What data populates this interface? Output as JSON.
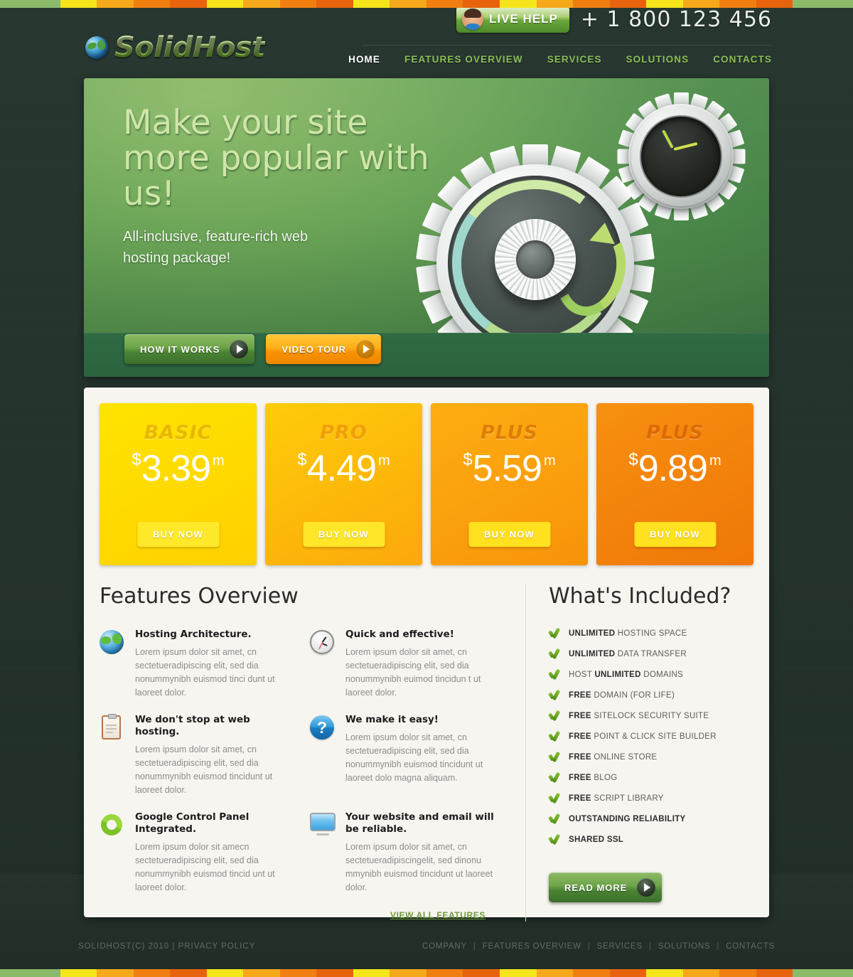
{
  "brand": {
    "name": "SolidHost",
    "logo_icon": "globe-icon"
  },
  "topbar": {
    "live_help_label": "LIVE HELP",
    "live_help_icon": "support-agent-avatar",
    "phone": "+ 1 800 123 456"
  },
  "nav": [
    {
      "label": "HOME",
      "active": true
    },
    {
      "label": "FEATURES OVERVIEW",
      "active": false
    },
    {
      "label": "SERVICES",
      "active": false
    },
    {
      "label": "SOLUTIONS",
      "active": false
    },
    {
      "label": "CONTACTS",
      "active": false
    }
  ],
  "hero": {
    "headline": "Make your site more popular with us!",
    "subhead": "All-inclusive, feature-rich web hosting package!",
    "primary_button": "HOW IT WORKS",
    "secondary_button": "VIDEO TOUR",
    "illustration": "gears-and-clock-icon"
  },
  "plans": [
    {
      "name": "BASIC",
      "currency": "$",
      "amount": "3.39",
      "period": "m",
      "buy_label": "BUY NOW",
      "bg_from": "#ffe400",
      "bg_to": "#ffd000",
      "name_color": "#e8b800",
      "buy_bg": "#ffe92a",
      "buy_text": "#ffffff"
    },
    {
      "name": "PRO",
      "currency": "$",
      "amount": "4.49",
      "period": "m",
      "buy_label": "BUY NOW",
      "bg_from": "#ffcc09",
      "bg_to": "#fba80b",
      "name_color": "#ef9f07",
      "buy_bg": "#ffe629",
      "buy_text": "#ffffff"
    },
    {
      "name": "PLUS",
      "currency": "$",
      "amount": "5.59",
      "period": "m",
      "buy_label": "BUY NOW",
      "bg_from": "#fdae11",
      "bg_to": "#f8930a",
      "name_color": "#e07d05",
      "buy_bg": "#ffe11f",
      "buy_text": "#ffffff"
    },
    {
      "name": "PLUS",
      "currency": "$",
      "amount": "9.89",
      "period": "m",
      "buy_label": "BUY NOW",
      "bg_from": "#f79010",
      "bg_to": "#ef7707",
      "name_color": "#de6a04",
      "buy_bg": "#ffe11f",
      "buy_text": "#ffffff"
    }
  ],
  "features": {
    "title": "Features Overview",
    "items": [
      {
        "icon": "globe-icon",
        "title": "Hosting Architecture.",
        "body": "Lorem ipsum dolor sit amet, cn sectetueradipiscing elit, sed dia nonummynibh euismod tinci dunt ut laoreet dolor."
      },
      {
        "icon": "clock-icon",
        "title": "Quick and effective!",
        "body": "Lorem ipsum dolor sit amet, cn sectetueradipiscing elit, sed dia nonummynibh euimod tincidun t ut laoreet dolor."
      },
      {
        "icon": "clipboard-icon",
        "title": "We don't stop at web hosting.",
        "body": "Lorem ipsum dolor sit amet, cn sectetueradipiscing elit, sed dia nonummynibh euismod tincidunt ut laoreet dolor."
      },
      {
        "icon": "question-mark-icon",
        "title": "We make it easy!",
        "body": "Lorem ipsum dolor sit amet, cn sectetueradipiscing elit, sed dia nonummynibh euismod tincidunt ut laoreet dolo magna aliquam."
      },
      {
        "icon": "refresh-cycle-icon",
        "title": "Google Control Panel Integrated.",
        "body": "Lorem ipsum dolor sit amecn sectetueradipiscing elit, sed dia nonummynibh euismod tincid unt ut laoreet dolor."
      },
      {
        "icon": "monitor-icon",
        "title": "Your website and email will be reliable.",
        "body": "Lorem ipsum dolor sit amet, cn sectetueradipiscingelit, sed dinonu mmynibh euismod tincidunt ut laoreet dolor."
      }
    ],
    "view_all_label": "VIEW ALL FEATURES"
  },
  "included": {
    "title": "What's Included?",
    "items": [
      {
        "strong": "UNLIMITED",
        "rest": " HOSTING SPACE",
        "strong_first": true
      },
      {
        "strong": "UNLIMITED",
        "rest": " DATA TRANSFER",
        "strong_first": true
      },
      {
        "pre": "HOST ",
        "strong": "UNLIMITED",
        "rest": " DOMAINS",
        "strong_first": false
      },
      {
        "strong": "FREE",
        "rest": " DOMAIN (FOR LIFE)",
        "strong_first": true
      },
      {
        "strong": "FREE",
        "rest": " SITELOCK SECURITY SUITE",
        "strong_first": true
      },
      {
        "strong": "FREE",
        "rest": " POINT & CLICK SITE BUILDER",
        "strong_first": true
      },
      {
        "strong": "FREE",
        "rest": " ONLINE STORE",
        "strong_first": true
      },
      {
        "strong": "FREE",
        "rest": " BLOG",
        "strong_first": true
      },
      {
        "strong": "FREE",
        "rest": " SCRIPT LIBRARY",
        "strong_first": true
      },
      {
        "strong": "OUTSTANDING RELIABILITY",
        "rest": "",
        "strong_first": true
      },
      {
        "strong": "SHARED SSL",
        "rest": "",
        "strong_first": true
      }
    ],
    "read_more_label": "READ MORE"
  },
  "footer": {
    "copyright": "SOLIDHOST(C) 2010  |  PRIVACY POLICY",
    "links": [
      "COMPANY",
      "FEATURES OVERVIEW",
      "SERVICES",
      "SOLUTIONS",
      "CONTACTS"
    ]
  },
  "strip_colors": [
    "#8cba6b",
    "#f5e61c",
    "#f6a81b",
    "#f07f12",
    "#e8630d"
  ]
}
